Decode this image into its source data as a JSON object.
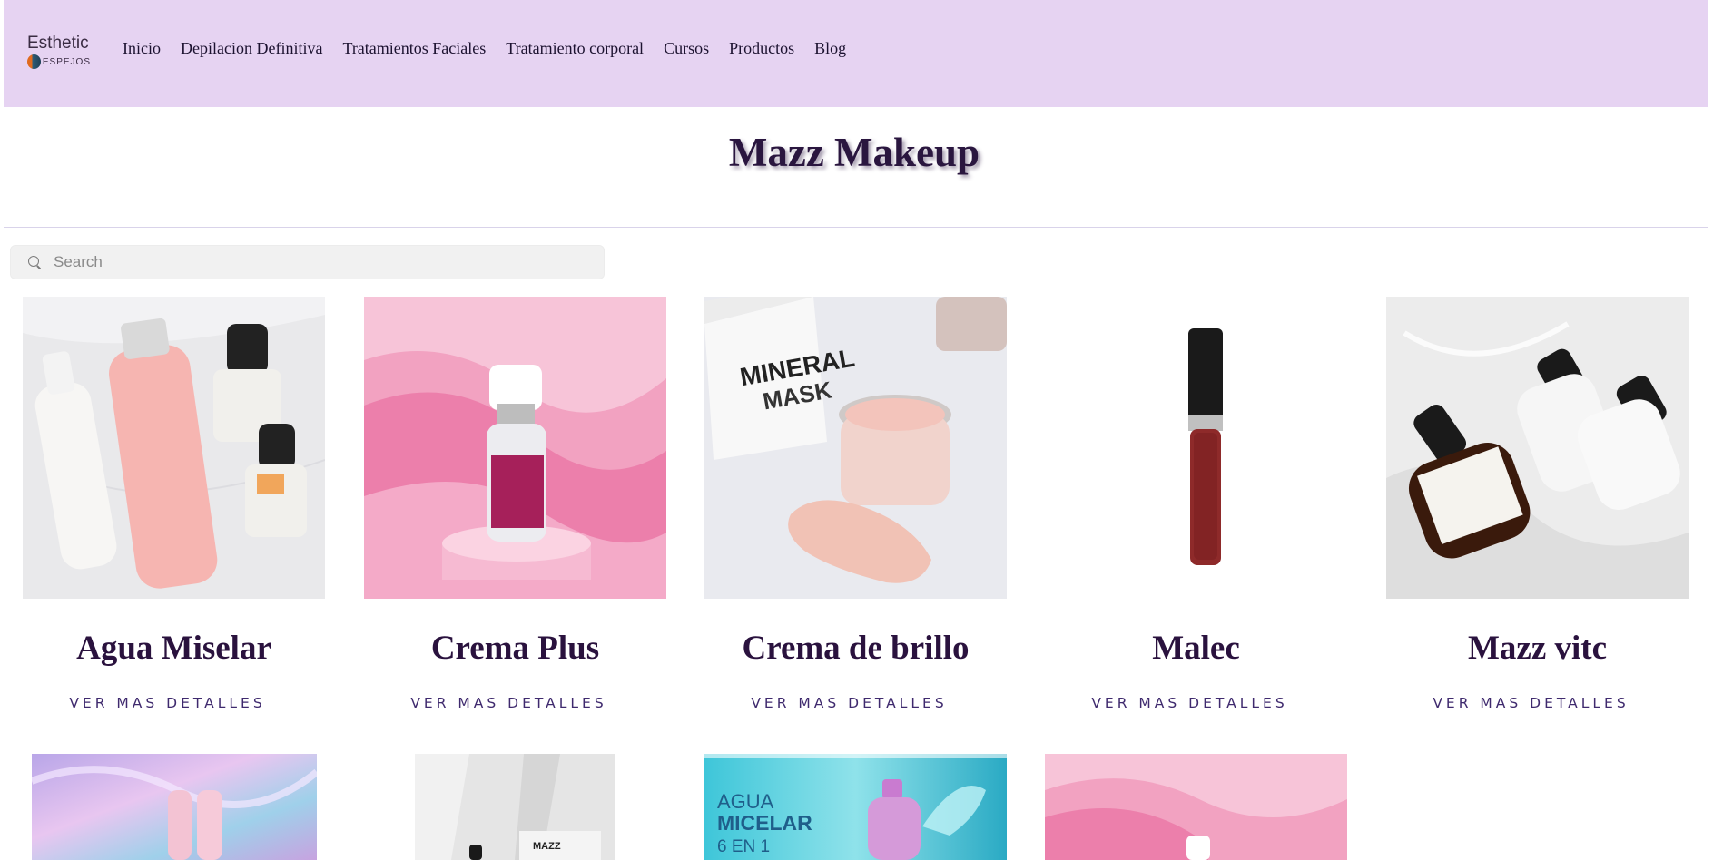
{
  "header": {
    "logo": {
      "title": "Esthetic",
      "subtitle": "ESPEJOS"
    },
    "nav": [
      "Inicio",
      "Depilacion Definitiva",
      "Tratamientos Faciales",
      "Tratamiento corporal",
      "Cursos",
      "Productos",
      "Blog"
    ]
  },
  "page": {
    "title": "Mazz Makeup"
  },
  "search": {
    "placeholder": "Search",
    "value": ""
  },
  "products": [
    {
      "name": "Agua Miselar",
      "link": "VER MAS DETALLES",
      "image": "agua-miselar-image"
    },
    {
      "name": "Crema Plus",
      "link": "VER MAS DETALLES",
      "image": "crema-plus-image"
    },
    {
      "name": "Crema de brillo",
      "link": "VER MAS DETALLES",
      "image": "crema-de-brillo-image"
    },
    {
      "name": "Malec",
      "link": "VER MAS DETALLES",
      "image": "malec-image"
    },
    {
      "name": "Mazz vitc",
      "link": "VER MAS DETALLES",
      "image": "mazz-vitc-image"
    }
  ],
  "second_row": [
    {
      "image": "lipstick-iridescent-image"
    },
    {
      "image": "mazz-white-bottle-image"
    },
    {
      "image": "agua-micelar-banner-image",
      "banner_lines": [
        "AGUA",
        "MICELAR",
        "6 EN 1"
      ]
    },
    {
      "image": "pink-waves-image"
    }
  ],
  "colors": {
    "header_bg": "#e6d3f2",
    "title": "#2a163f",
    "product_name": "#2a123e",
    "link": "#3f2a6e"
  }
}
